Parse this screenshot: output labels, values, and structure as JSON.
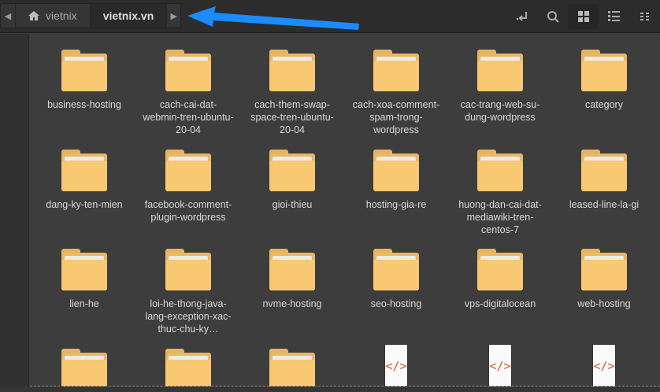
{
  "breadcrumb": {
    "items": [
      {
        "label": "vietnix",
        "icon": "home-icon"
      },
      {
        "label": "vietnix.vn"
      }
    ]
  },
  "toolbar": {
    "icons": [
      "open-location-icon",
      "search-icon",
      "grid-view-icon",
      "list-view-icon",
      "compact-view-icon"
    ]
  },
  "annotation": {
    "color": "#1a8cff"
  },
  "files": [
    {
      "name": "business-hosting",
      "type": "folder"
    },
    {
      "name": "cach-cai-dat-webmin-tren-ubuntu-20-04",
      "type": "folder"
    },
    {
      "name": "cach-them-swap-space-tren-ubuntu-20-04",
      "type": "folder"
    },
    {
      "name": "cach-xoa-comment-spam-trong-wordpress",
      "type": "folder"
    },
    {
      "name": "cac-trang-web-su-dung-wordpress",
      "type": "folder"
    },
    {
      "name": "category",
      "type": "folder"
    },
    {
      "name": "dang-ky-ten-mien",
      "type": "folder"
    },
    {
      "name": "facebook-comment-plugin-wordpress",
      "type": "folder"
    },
    {
      "name": "gioi-thieu",
      "type": "folder"
    },
    {
      "name": "hosting-gia-re",
      "type": "folder"
    },
    {
      "name": "huong-dan-cai-dat-mediawiki-tren-centos-7",
      "type": "folder"
    },
    {
      "name": "leased-line-la-gi",
      "type": "folder"
    },
    {
      "name": "lien-he",
      "type": "folder"
    },
    {
      "name": "loi-he-thong-java-lang-exception-xac-thuc-chu-ky…",
      "type": "folder"
    },
    {
      "name": "nvme-hosting",
      "type": "folder"
    },
    {
      "name": "seo-hosting",
      "type": "folder"
    },
    {
      "name": "vps-digitalocean",
      "type": "folder"
    },
    {
      "name": "web-hosting",
      "type": "folder"
    },
    {
      "name": "",
      "type": "folder"
    },
    {
      "name": "",
      "type": "folder"
    },
    {
      "name": "",
      "type": "folder"
    },
    {
      "name": "",
      "type": "code",
      "glyph": "</>"
    },
    {
      "name": "",
      "type": "code",
      "glyph": "</>"
    },
    {
      "name": "",
      "type": "code",
      "glyph": "</>"
    }
  ]
}
